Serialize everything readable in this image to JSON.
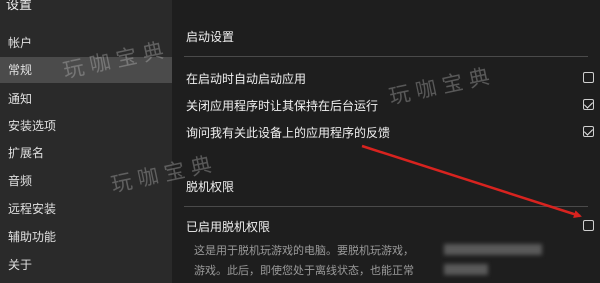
{
  "sidebar": {
    "title": "设置",
    "items": [
      {
        "label": "帐户"
      },
      {
        "label": "常规"
      },
      {
        "label": "通知"
      },
      {
        "label": "安装选项"
      },
      {
        "label": "扩展名"
      },
      {
        "label": "音频"
      },
      {
        "label": "远程安装"
      },
      {
        "label": "辅助功能"
      },
      {
        "label": "关于"
      }
    ],
    "selected": "常规"
  },
  "main": {
    "startup_section": {
      "title": "启动设置",
      "options": [
        {
          "label": "在启动时自动启动应用",
          "checked": false
        },
        {
          "label": "关闭应用程序时让其保持在后台运行",
          "checked": true
        },
        {
          "label": "询问我有关此设备上的应用程序的反馈",
          "checked": true
        }
      ]
    },
    "offline_section": {
      "title": "脱机权限",
      "option": {
        "label": "已启用脱机权限",
        "checked": false
      },
      "description_line1": "这是用于脱机玩游戏的电脑。要脱机玩游戏，",
      "description_line2": "游戏。此后，即使您处于离线状态，也能正常"
    }
  },
  "watermark": "玩咖宝典",
  "colors": {
    "annotation_arrow": "#d8231f",
    "background": "#1e1e1e",
    "sidebar": "#2a2a2a"
  }
}
